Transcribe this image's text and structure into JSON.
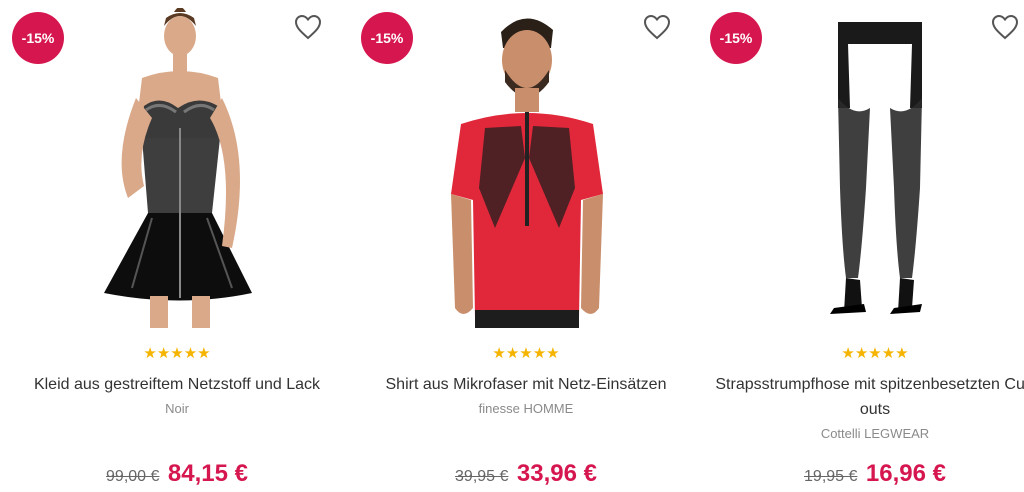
{
  "products": [
    {
      "badge": "-15%",
      "title": "Kleid aus gestreiftem Netzstoff und Lack",
      "brand": "Noir",
      "old_price": "99,00 €",
      "new_price": "84,15 €",
      "stars": "★★★★★",
      "rating": 5
    },
    {
      "badge": "-15%",
      "title": "Shirt aus Mikrofaser mit Netz-Einsätzen",
      "brand": "finesse HOMME",
      "old_price": "39,95 €",
      "new_price": "33,96 €",
      "stars": "★★★★★",
      "rating": 5
    },
    {
      "badge": "-15%",
      "title": "Strapsstrumpfhose mit spitzenbesetzten Cut-outs",
      "brand": "Cottelli LEGWEAR",
      "old_price": "19,95 €",
      "new_price": "16,96 €",
      "stars": "★★★★★",
      "rating": 5
    }
  ],
  "colors": {
    "accent": "#d6164f",
    "star": "#f5b400",
    "muted": "#8a8a8a"
  },
  "icons": {
    "wishlist": "heart-outline-icon",
    "rating": "star-icon"
  }
}
